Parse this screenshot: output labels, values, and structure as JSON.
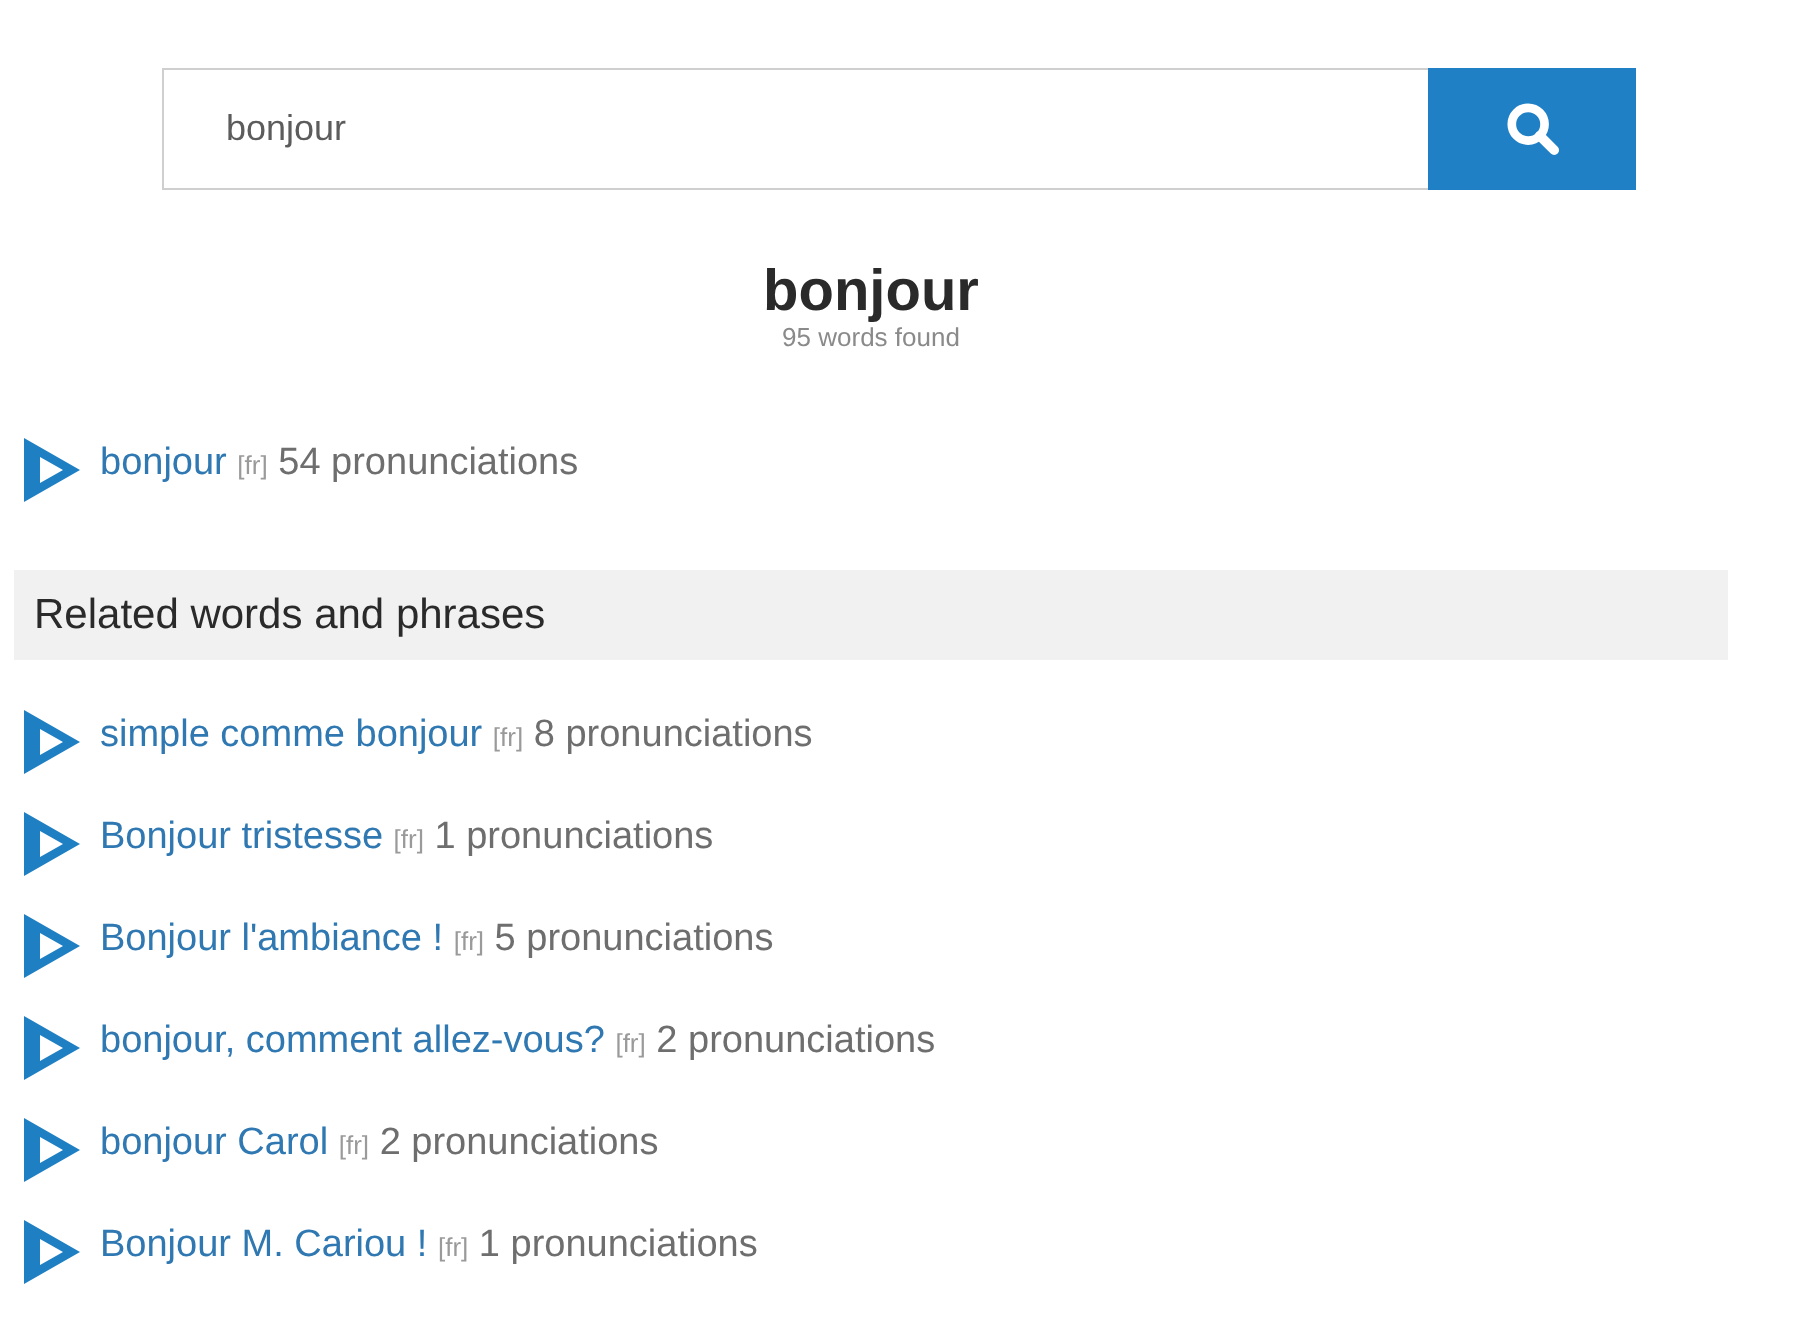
{
  "search": {
    "value": "bonjour"
  },
  "heading": {
    "title": "bonjour",
    "subtitle": "95 words found"
  },
  "main_entries": [
    {
      "word": "bonjour",
      "language": "[fr]",
      "count": "54 pronunciations"
    }
  ],
  "related": {
    "title": "Related words and phrases",
    "items": [
      {
        "word": "simple comme bonjour",
        "language": "[fr]",
        "count": "8 pronunciations"
      },
      {
        "word": "Bonjour tristesse",
        "language": "[fr]",
        "count": "1 pronunciations"
      },
      {
        "word": "Bonjour l'ambiance !",
        "language": "[fr]",
        "count": "5 pronunciations"
      },
      {
        "word": "bonjour, comment allez-vous?",
        "language": "[fr]",
        "count": "2 pronunciations"
      },
      {
        "word": "bonjour Carol",
        "language": "[fr]",
        "count": "2 pronunciations"
      },
      {
        "word": "Bonjour M. Cariou !",
        "language": "[fr]",
        "count": "1 pronunciations"
      }
    ]
  }
}
